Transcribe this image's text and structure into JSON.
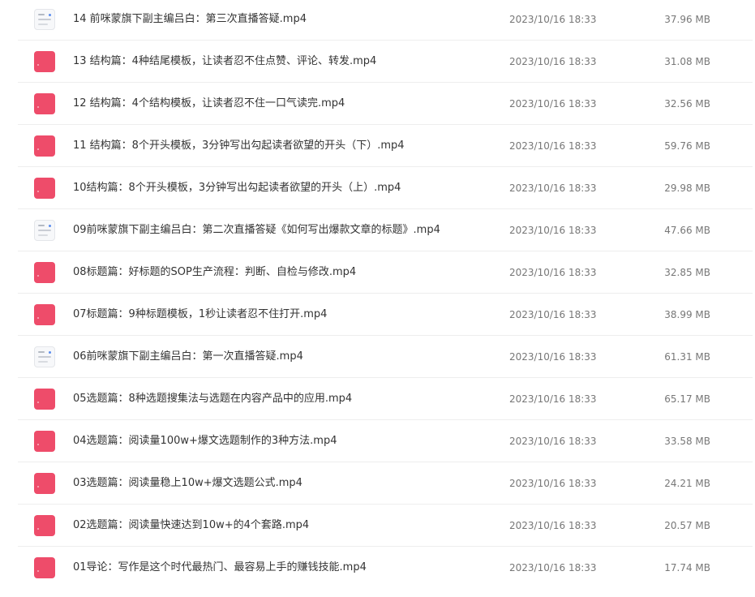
{
  "files": [
    {
      "name": "14 前咪蒙旗下副主编吕白：第三次直播答疑.mp4",
      "date": "2023/10/16 18:33",
      "size": "37.96 MB",
      "thumb": "screen"
    },
    {
      "name": "13 结构篇：4种结尾模板，让读者忍不住点赞、评论、转发.mp4",
      "date": "2023/10/16 18:33",
      "size": "31.08 MB",
      "thumb": "video"
    },
    {
      "name": "12 结构篇：4个结构模板，让读者忍不住一口气读完.mp4",
      "date": "2023/10/16 18:33",
      "size": "32.56 MB",
      "thumb": "video"
    },
    {
      "name": "11 结构篇：8个开头模板，3分钟写出勾起读者欲望的开头（下）.mp4",
      "date": "2023/10/16 18:33",
      "size": "59.76 MB",
      "thumb": "video"
    },
    {
      "name": "10结构篇：8个开头模板，3分钟写出勾起读者欲望的开头（上）.mp4",
      "date": "2023/10/16 18:33",
      "size": "29.98 MB",
      "thumb": "video"
    },
    {
      "name": "09前咪蒙旗下副主编吕白：第二次直播答疑《如何写出爆款文章的标题》.mp4",
      "date": "2023/10/16 18:33",
      "size": "47.66 MB",
      "thumb": "screen"
    },
    {
      "name": "08标题篇：好标题的SOP生产流程：判断、自检与修改.mp4",
      "date": "2023/10/16 18:33",
      "size": "32.85 MB",
      "thumb": "video"
    },
    {
      "name": "07标题篇：9种标题模板，1秒让读者忍不住打开.mp4",
      "date": "2023/10/16 18:33",
      "size": "38.99 MB",
      "thumb": "video"
    },
    {
      "name": "06前咪蒙旗下副主编吕白：第一次直播答疑.mp4",
      "date": "2023/10/16 18:33",
      "size": "61.31 MB",
      "thumb": "screen"
    },
    {
      "name": "05选题篇：8种选题搜集法与选题在内容产品中的应用.mp4",
      "date": "2023/10/16 18:33",
      "size": "65.17 MB",
      "thumb": "video"
    },
    {
      "name": "04选题篇：阅读量100w+爆文选题制作的3种方法.mp4",
      "date": "2023/10/16 18:33",
      "size": "33.58 MB",
      "thumb": "video"
    },
    {
      "name": "03选题篇：阅读量稳上10w+爆文选题公式.mp4",
      "date": "2023/10/16 18:33",
      "size": "24.21 MB",
      "thumb": "video"
    },
    {
      "name": "02选题篇：阅读量快速达到10w+的4个套路.mp4",
      "date": "2023/10/16 18:33",
      "size": "20.57 MB",
      "thumb": "video"
    },
    {
      "name": "01导论：写作是这个时代最热门、最容易上手的赚钱技能.mp4",
      "date": "2023/10/16 18:33",
      "size": "17.74 MB",
      "thumb": "video"
    }
  ]
}
